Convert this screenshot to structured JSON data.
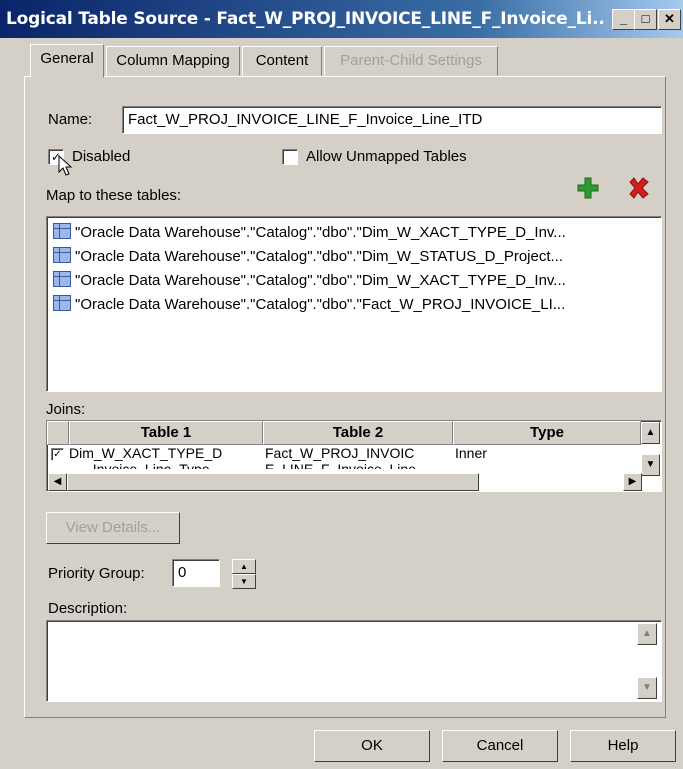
{
  "window": {
    "title": "Logical Table Source - Fact_W_PROJ_INVOICE_LINE_F_Invoice_Li..."
  },
  "tabs": [
    {
      "label": "General"
    },
    {
      "label": "Column Mapping"
    },
    {
      "label": "Content"
    },
    {
      "label": "Parent-Child Settings"
    }
  ],
  "general": {
    "name_label": "Name:",
    "name_value": "Fact_W_PROJ_INVOICE_LINE_F_Invoice_Line_ITD",
    "disabled_label": "Disabled",
    "disabled_checked": true,
    "allow_unmapped_label": "Allow Unmapped Tables",
    "allow_unmapped_checked": false,
    "map_tables_label": "Map to these tables:",
    "tables": [
      "\"Oracle Data Warehouse\".\"Catalog\".\"dbo\".\"Dim_W_XACT_TYPE_D_Inv...",
      "\"Oracle Data Warehouse\".\"Catalog\".\"dbo\".\"Dim_W_STATUS_D_Project...",
      "\"Oracle Data Warehouse\".\"Catalog\".\"dbo\".\"Dim_W_XACT_TYPE_D_Inv...",
      "\"Oracle Data Warehouse\".\"Catalog\".\"dbo\".\"Fact_W_PROJ_INVOICE_LI..."
    ],
    "joins_label": "Joins:",
    "joins_headers": [
      "Table 1",
      "Table 2",
      "Type"
    ],
    "joins_rows": [
      {
        "table1": "Dim_W_XACT_TYPE_D",
        "table1b": "_Invoice_Line_Type",
        "table2": "Fact_W_PROJ_INVOIC",
        "table2b": "E_LINE_F_Invoice_Line",
        "type": "Inner",
        "checked": true
      }
    ],
    "view_details_label": "View Details...",
    "priority_label": "Priority Group:",
    "priority_value": "0",
    "description_label": "Description:",
    "description_value": ""
  },
  "buttons": {
    "ok": "OK",
    "cancel": "Cancel",
    "help": "Help"
  },
  "icons": {
    "add": "plus-icon",
    "delete": "x-icon",
    "add_color": "#2e9a2e",
    "delete_color": "#d02020"
  }
}
